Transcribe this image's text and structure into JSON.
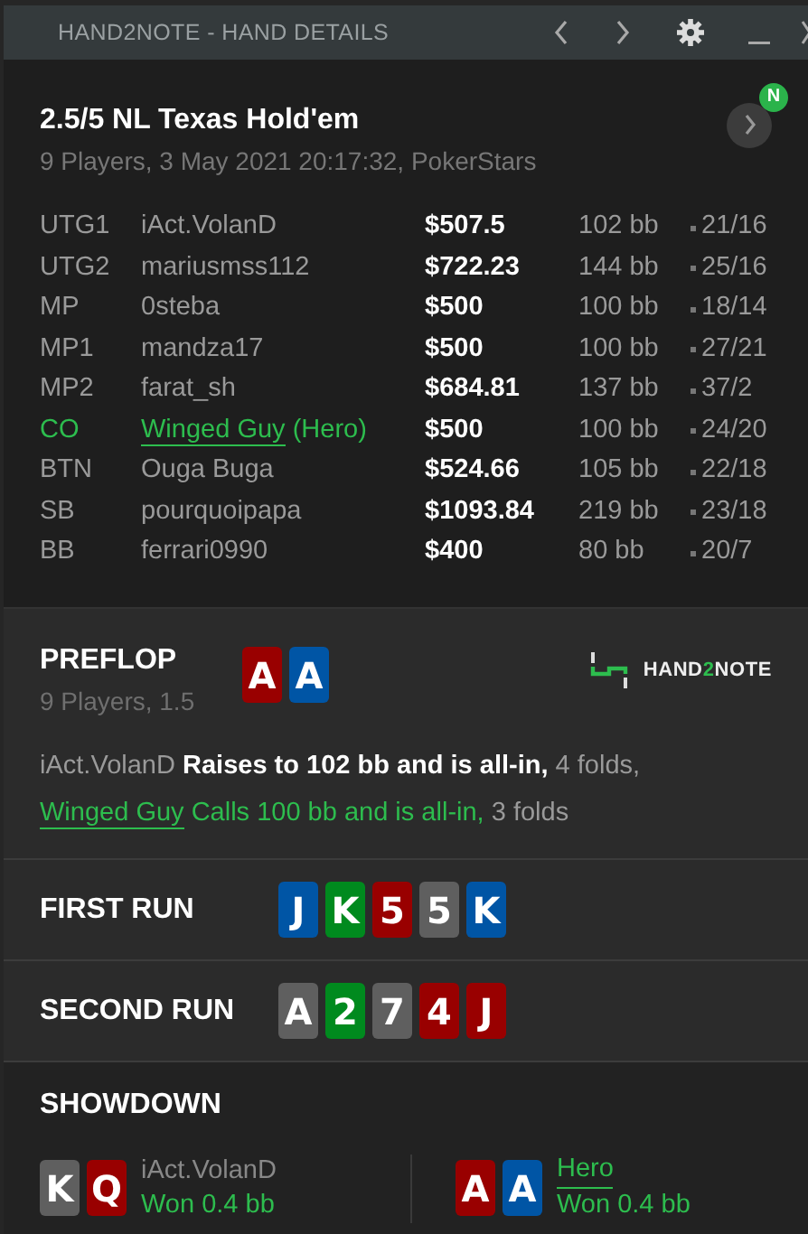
{
  "window": {
    "title": "HAND2NOTE - HAND DETAILS"
  },
  "header": {
    "title": "2.5/5 NL Texas Hold'em",
    "subtitle": "9 Players, 3 May 2021 20:17:32, PokerStars",
    "badge": "N"
  },
  "players": [
    {
      "position": "UTG1",
      "name": "iAct.VolanD",
      "stack": "$507.5",
      "bb": "102 bb",
      "stats": "21/16",
      "hero": false
    },
    {
      "position": "UTG2",
      "name": "mariusmss112",
      "stack": "$722.23",
      "bb": "144 bb",
      "stats": "25/16",
      "hero": false
    },
    {
      "position": "MP",
      "name": "0steba",
      "stack": "$500",
      "bb": "100 bb",
      "stats": "18/14",
      "hero": false
    },
    {
      "position": "MP1",
      "name": "mandza17",
      "stack": "$500",
      "bb": "100 bb",
      "stats": "27/21",
      "hero": false
    },
    {
      "position": "MP2",
      "name": "farat_sh",
      "stack": "$684.81",
      "bb": "137 bb",
      "stats": "37/2",
      "hero": false
    },
    {
      "position": "CO",
      "name": "Winged Guy",
      "suffix": "(Hero)",
      "stack": "$500",
      "bb": "100 bb",
      "stats": "24/20",
      "hero": true
    },
    {
      "position": "BTN",
      "name": "Ouga Buga",
      "stack": "$524.66",
      "bb": "105 bb",
      "stats": "22/18",
      "hero": false
    },
    {
      "position": "SB",
      "name": "pourquoipapa",
      "stack": "$1093.84",
      "bb": "219 bb",
      "stats": "23/18",
      "hero": false
    },
    {
      "position": "BB",
      "name": "ferrari0990",
      "stack": "$400",
      "bb": "80 bb",
      "stats": "20/7",
      "hero": false
    }
  ],
  "preflop": {
    "title": "PREFLOP",
    "subtitle": "9 Players, 1.5",
    "cards": [
      {
        "rank": "A",
        "color": "#990000"
      },
      {
        "rank": "A",
        "color": "#0055a5"
      }
    ],
    "logo": [
      {
        "text": "HAND",
        "accent": false
      },
      {
        "text": "2",
        "accent": true
      },
      {
        "text": "NOTE",
        "accent": false
      }
    ],
    "actions": [
      [
        {
          "text": "iAct.VolanD",
          "kind": "player"
        },
        {
          "text": "Raises to 102 bb and is all-in,",
          "kind": "action"
        },
        {
          "text": "4 folds,",
          "kind": "folds"
        }
      ],
      [
        {
          "text": "Winged Guy",
          "kind": "hero"
        },
        {
          "text": "Calls 100 bb and is all-in,",
          "kind": "hero-action"
        },
        {
          "text": "3 folds",
          "kind": "folds"
        }
      ]
    ]
  },
  "runs": [
    {
      "title": "FIRST RUN",
      "cards": [
        {
          "rank": "J",
          "color": "#0055a5"
        },
        {
          "rank": "K",
          "color": "#008a1e"
        },
        {
          "rank": "5",
          "color": "#990000"
        },
        {
          "rank": "5",
          "color": "#5f5f5f"
        },
        {
          "rank": "K",
          "color": "#0055a5"
        }
      ]
    },
    {
      "title": "SECOND RUN",
      "cards": [
        {
          "rank": "A",
          "color": "#5f5f5f"
        },
        {
          "rank": "2",
          "color": "#008a1e"
        },
        {
          "rank": "7",
          "color": "#5f5f5f"
        },
        {
          "rank": "4",
          "color": "#990000"
        },
        {
          "rank": "J",
          "color": "#990000"
        }
      ]
    }
  ],
  "showdown": {
    "title": "SHOWDOWN",
    "players": [
      {
        "name": "iAct.VolanD",
        "result": "Won 0.4 bb",
        "hero": false,
        "cards": [
          {
            "rank": "K",
            "color": "#5f5f5f"
          },
          {
            "rank": "Q",
            "color": "#990000"
          }
        ]
      },
      {
        "name": "Hero",
        "result": "Won 0.4 bb",
        "hero": true,
        "cards": [
          {
            "rank": "A",
            "color": "#990000"
          },
          {
            "rank": "A",
            "color": "#0055a5"
          }
        ]
      }
    ]
  }
}
